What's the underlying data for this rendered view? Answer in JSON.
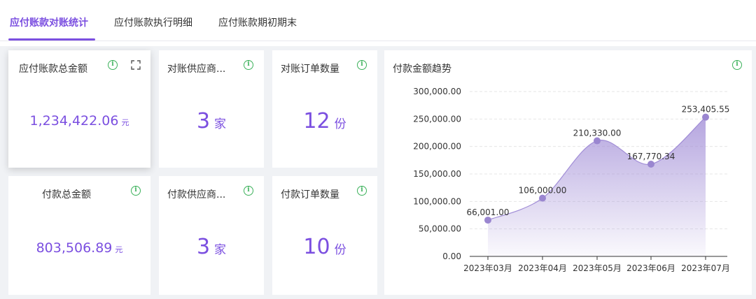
{
  "tabs": [
    {
      "label": "应付账款对账统计",
      "active": true
    },
    {
      "label": "应付账款执行明细",
      "active": false
    },
    {
      "label": "应付账款期初期末",
      "active": false
    }
  ],
  "cards": {
    "payable_total": {
      "title": "应付账款总金额",
      "value": "1,234,422.06",
      "unit": "元"
    },
    "recon_suppliers": {
      "title": "对账供应商...",
      "value": "3",
      "unit": "家"
    },
    "recon_orders": {
      "title": "对账订单数量",
      "value": "12",
      "unit": "份"
    },
    "payment_total": {
      "title": "付款总金额",
      "value": "803,506.89",
      "unit": "元"
    },
    "pay_suppliers": {
      "title": "付款供应商...",
      "value": "3",
      "unit": "家"
    },
    "pay_orders": {
      "title": "付款订单数量",
      "value": "10",
      "unit": "份"
    }
  },
  "icons": {
    "info": "info-circle-icon",
    "expand": "fullscreen-expand-icon"
  },
  "colors": {
    "accent": "#7b4fe0",
    "info": "#3bb15a",
    "series": "#a08cd6"
  },
  "chart_data": {
    "type": "area",
    "title": "付款金额趋势",
    "categories": [
      "2023年03月",
      "2023年04月",
      "2023年05月",
      "2023年06月",
      "2023年07月"
    ],
    "values": [
      66001.0,
      106000.0,
      210330.0,
      167770.34,
      253405.55
    ],
    "data_labels": [
      "66,001.00",
      "106,000.00",
      "210,330.00",
      "167,770.34",
      "253,405.55"
    ],
    "yticks": [
      "0.00",
      "50,000.00",
      "100,000.00",
      "150,000.00",
      "200,000.00",
      "250,000.00",
      "300,000.00"
    ],
    "ylim": [
      0,
      300000
    ],
    "grid": true,
    "smooth": true
  }
}
